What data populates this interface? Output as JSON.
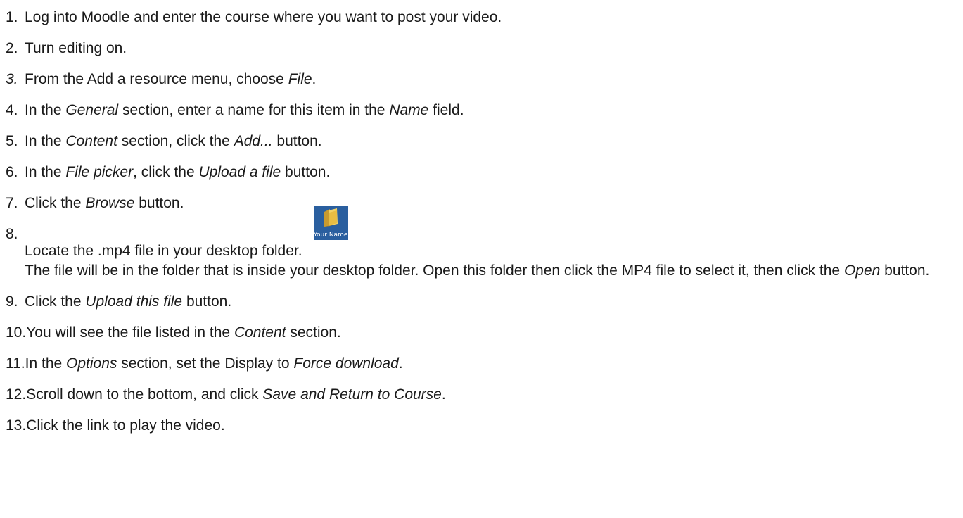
{
  "steps": [
    {
      "number": "1.",
      "text": "Log into Moodle and enter the course where you want to post your video."
    },
    {
      "number": "2.",
      "text": "Turn editing on."
    },
    {
      "number": "3.",
      "parts": [
        "From the Add a resource menu, choose ",
        "File",
        "."
      ]
    },
    {
      "number": "4.",
      "parts": [
        "In the ",
        "General",
        " section, enter a name for this item in the ",
        "Name",
        " field."
      ]
    },
    {
      "number": "5.",
      "parts": [
        "In the ",
        "Content",
        " section, click the ",
        "Add...",
        " button."
      ]
    },
    {
      "number": "6.",
      "parts": [
        "In the ",
        "File picker",
        ", click the ",
        "Upload a file",
        " button."
      ]
    },
    {
      "number": "7.",
      "parts": [
        "Click the ",
        "Browse",
        " button."
      ]
    },
    {
      "number": "8.",
      "text": "Locate the .mp4 file in your desktop folder.",
      "icon": {
        "name": "folder-icon",
        "label": "Your Name",
        "bg_color": "#2a5f9f",
        "folder_color": "#f2d266"
      },
      "detail_parts": [
        "The file will be in the folder that is inside your desktop folder. Open this folder then click the MP4 file to select it, then click the ",
        "Open",
        " button."
      ]
    },
    {
      "number": "9.",
      "parts": [
        "Click the ",
        "Upload this file",
        " button."
      ]
    },
    {
      "number": "10.",
      "parts": [
        "You will see the file listed in the ",
        "Content",
        " section."
      ]
    },
    {
      "number": "11.",
      "parts": [
        "In the ",
        "Options",
        " section, set the Display to ",
        "Force download",
        "."
      ]
    },
    {
      "number": "12.",
      "parts": [
        "Scroll down to the bottom, and click ",
        "Save and Return to Course",
        "."
      ]
    },
    {
      "number": "13.",
      "text": "Click the link to play the video."
    }
  ]
}
